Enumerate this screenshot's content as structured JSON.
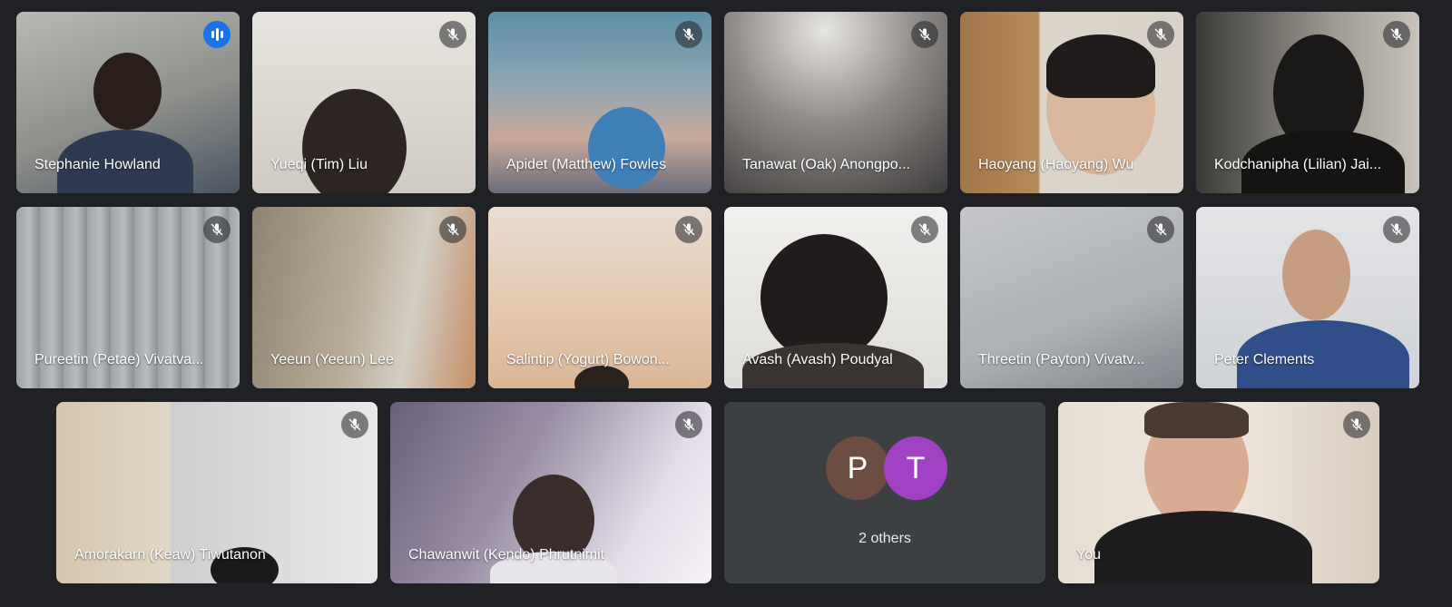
{
  "participants": [
    {
      "name": "Stephanie Howland",
      "status": "speaking"
    },
    {
      "name": "Yueqi (Tim) Liu",
      "status": "muted"
    },
    {
      "name": "Apidet (Matthew) Fowles",
      "status": "muted"
    },
    {
      "name": "Tanawat (Oak) Anongpo...",
      "status": "muted"
    },
    {
      "name": "Haoyang (Haoyang) Wu",
      "status": "muted"
    },
    {
      "name": "Kodchanipha (Lilian) Jai...",
      "status": "muted"
    },
    {
      "name": "Pureetin (Petae) Vivatva...",
      "status": "muted"
    },
    {
      "name": "Yeeun (Yeeun) Lee",
      "status": "muted"
    },
    {
      "name": "Salintip (Yogurt) Bowon...",
      "status": "muted"
    },
    {
      "name": "Avash (Avash) Poudyal",
      "status": "muted"
    },
    {
      "name": "Threetin (Payton) Vivatv...",
      "status": "muted"
    },
    {
      "name": "Peter Clements",
      "status": "muted"
    },
    {
      "name": "Amorakarn (Keaw) Tiwutanon",
      "status": "muted"
    },
    {
      "name": "Chawanwit (Kendo) Phrutnimit",
      "status": "muted"
    },
    {
      "name": "You",
      "status": "muted"
    }
  ],
  "others_tile": {
    "avatars": [
      {
        "initial": "P",
        "color": "#6d4c41"
      },
      {
        "initial": "T",
        "color": "#a142c4"
      }
    ],
    "label": "2 others"
  },
  "icons": {
    "muted": "mic-off-icon",
    "speaking": "audio-level-icon"
  },
  "colors": {
    "background": "#202124",
    "active_border": "#8ab4f8",
    "speaking": "#1a73e8"
  }
}
